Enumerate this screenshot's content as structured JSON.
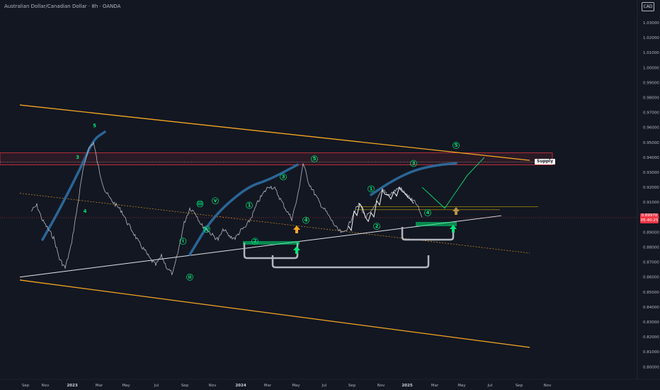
{
  "header": {
    "title": "Australian Dollar/Canadian Dollar · 8h · OANDA",
    "currency": "CAD"
  },
  "price_tag": {
    "price": "0.89970",
    "countdown": "05:40:25"
  },
  "annotations": {
    "supply_label": "Supply"
  },
  "colors": {
    "background": "#131722",
    "channel": "#f5a623",
    "trendline": "#e0e3eb",
    "wave": "#00e676",
    "arc": "#2e6fa3",
    "supply_zone": "#f23645",
    "price_line": "#d1d4dc",
    "projection": "#ffffff"
  },
  "chart_data": {
    "type": "line",
    "title": "",
    "symbol": "AUDCAD",
    "timeframe": "8h",
    "xlabel": "",
    "ylabel": "",
    "ylim": [
      0.79,
      1.045
    ],
    "y_ticks": [
      "1.03000",
      "1.02000",
      "1.01000",
      "1.00000",
      "0.99000",
      "0.98000",
      "0.97000",
      "0.96000",
      "0.95000",
      "0.94000",
      "0.93000",
      "0.92000",
      "0.91000",
      "0.90000",
      "0.89000",
      "0.88000",
      "0.87000",
      "0.86000",
      "0.85000",
      "0.84000",
      "0.83000",
      "0.82000",
      "0.81000",
      "0.80000"
    ],
    "x_ticks": [
      "Sep",
      "Nov",
      "2023",
      "Mar",
      "May",
      "Jul",
      "Sep",
      "Nov",
      "2024",
      "Mar",
      "May",
      "Jul",
      "Sep",
      "Nov",
      "2025",
      "Mar",
      "May",
      "Jul",
      "Sep",
      "Nov"
    ],
    "x_ticks_bold": [
      "2023",
      "2024",
      "2025"
    ],
    "last_price": 0.8997,
    "series": [
      {
        "x": [
          0,
          1,
          2,
          3,
          4,
          5,
          6,
          7,
          8,
          9,
          10,
          11,
          12,
          13,
          14,
          15,
          16,
          17,
          18,
          19,
          20,
          21,
          22,
          23,
          24,
          25,
          26,
          27,
          28,
          29,
          30,
          31,
          32,
          33,
          34,
          35,
          36,
          37,
          38,
          39,
          40,
          41,
          42,
          43,
          44,
          45,
          46,
          47,
          48,
          49,
          50,
          51,
          52,
          53,
          54,
          55,
          56,
          57,
          58,
          59,
          60,
          61,
          62,
          63,
          64,
          65,
          66,
          67,
          68,
          69
        ],
        "values": [
          0.904,
          0.908,
          0.898,
          0.892,
          0.886,
          0.872,
          0.866,
          0.88,
          0.903,
          0.928,
          0.945,
          0.95,
          0.931,
          0.918,
          0.912,
          0.908,
          0.904,
          0.896,
          0.89,
          0.883,
          0.878,
          0.872,
          0.868,
          0.874,
          0.866,
          0.862,
          0.878,
          0.896,
          0.906,
          0.903,
          0.895,
          0.892,
          0.888,
          0.885,
          0.892,
          0.887,
          0.886,
          0.891,
          0.894,
          0.901,
          0.91,
          0.916,
          0.921,
          0.919,
          0.912,
          0.905,
          0.899,
          0.913,
          0.936,
          0.923,
          0.916,
          0.909,
          0.904,
          0.898,
          0.892,
          0.889,
          0.894,
          0.904,
          0.909,
          0.9,
          0.903,
          0.911,
          0.918,
          0.915,
          0.917,
          0.92,
          0.916,
          0.912,
          0.909,
          0.9
        ]
      }
    ],
    "projection": {
      "x": [
        69,
        73,
        77,
        80
      ],
      "values": [
        0.92,
        0.906,
        0.928,
        0.94
      ]
    },
    "supply_zone": [
      0.935,
      0.943
    ],
    "levels": [
      {
        "name": "Supply",
        "value": 0.937
      },
      {
        "value": 0.907
      },
      {
        "value": 0.905
      }
    ],
    "channel_upper": {
      "x": [
        -2,
        88
      ],
      "values": [
        0.975,
        0.938
      ]
    },
    "channel_lower": {
      "x": [
        -2,
        88
      ],
      "values": [
        0.858,
        0.813
      ]
    },
    "channel_mid": {
      "x": [
        -2,
        88
      ],
      "values": [
        0.916,
        0.876
      ]
    },
    "trendline": {
      "x": [
        -2,
        83
      ],
      "values": [
        0.86,
        0.901
      ]
    },
    "arcs": [
      {
        "x": [
          2,
          5,
          9,
          11,
          13
        ],
        "values": [
          0.885,
          0.905,
          0.935,
          0.952,
          0.957
        ]
      },
      {
        "x": [
          28,
          32,
          38,
          42,
          47
        ],
        "values": [
          0.875,
          0.9,
          0.92,
          0.925,
          0.935
        ]
      },
      {
        "x": [
          60,
          64,
          68,
          72,
          75
        ],
        "values": [
          0.915,
          0.925,
          0.932,
          0.935,
          0.936
        ]
      }
    ],
    "wave_labels": [
      {
        "label": "3",
        "x": 8.2,
        "value": 0.939
      },
      {
        "label": "4",
        "x": 9.5,
        "value": 0.903
      },
      {
        "label": "5",
        "x": 11.2,
        "value": 0.96
      },
      {
        "label": "(i)",
        "x": 26.8,
        "value": 0.883
      },
      {
        "label": "(ii)",
        "x": 28.0,
        "value": 0.859
      },
      {
        "label": "(iii)",
        "x": 29.8,
        "value": 0.908
      },
      {
        "label": "(iv)",
        "x": 31.0,
        "value": 0.891
      },
      {
        "label": "(v)",
        "x": 32.5,
        "value": 0.91
      },
      {
        "label": "(1)",
        "x": 38.5,
        "value": 0.907
      },
      {
        "label": "(2)",
        "x": 39.5,
        "value": 0.883
      },
      {
        "label": "(3)",
        "x": 44.5,
        "value": 0.926
      },
      {
        "label": "(4)",
        "x": 48.5,
        "value": 0.897
      },
      {
        "label": "(5)",
        "x": 50.0,
        "value": 0.938
      },
      {
        "label": "(1)",
        "x": 60.0,
        "value": 0.918
      },
      {
        "label": "(2)",
        "x": 61.0,
        "value": 0.893
      },
      {
        "label": "(3)",
        "x": 67.5,
        "value": 0.935
      },
      {
        "label": "(4)",
        "x": 70.0,
        "value": 0.902
      },
      {
        "label": "(5)",
        "x": 75.0,
        "value": 0.947
      }
    ]
  }
}
